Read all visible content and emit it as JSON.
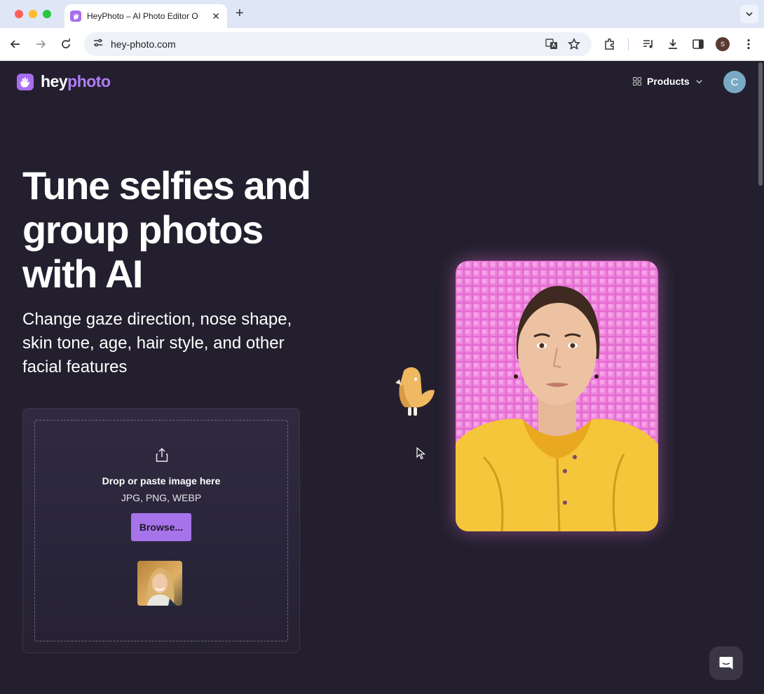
{
  "browser": {
    "tab_title": "HeyPhoto – AI Photo Editor O",
    "tab_close": "✕",
    "new_tab": "+",
    "url": "hey-photo.com",
    "profile_initial": "S"
  },
  "header": {
    "logo_hey": "hey",
    "logo_photo": "photo",
    "products_label": "Products",
    "avatar_initial": "C"
  },
  "hero": {
    "title": "Tune selfies and group photos with AI",
    "subtitle": "Change gaze direction, nose shape, skin tone, age, hair style, and other facial features"
  },
  "upload": {
    "drop_title": "Drop or paste image here",
    "formats": "JPG, PNG, WEBP",
    "browse_label": "Browse..."
  },
  "colors": {
    "background": "#231f2e",
    "accent": "#a673ea",
    "logo_photo": "#b07cf5",
    "portrait_backdrop": "#e56ad2",
    "jacket": "#f5c53a"
  },
  "icons": [
    "back-icon",
    "forward-icon",
    "reload-icon",
    "site-settings-icon",
    "translate-icon",
    "bookmark-star-icon",
    "extensions-icon",
    "media-control-icon",
    "download-icon",
    "side-panel-icon",
    "more-menu-icon",
    "grid-icon",
    "chevron-down-icon",
    "upload-icon",
    "chat-icon"
  ]
}
